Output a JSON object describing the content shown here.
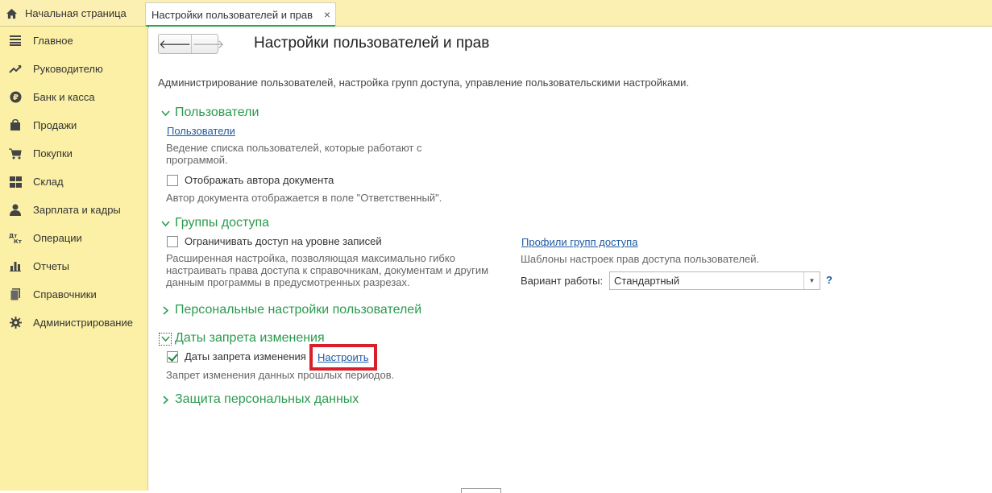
{
  "topbar": {
    "home_label": "Начальная страница",
    "active_tab_label": "Настройки пользователей и прав",
    "close_glyph": "×"
  },
  "sidebar": {
    "items": [
      {
        "label": "Главное",
        "icon": "menu-lines-icon"
      },
      {
        "label": "Руководителю",
        "icon": "trend-up-icon"
      },
      {
        "label": "Банк и касса",
        "icon": "ruble-coin-icon"
      },
      {
        "label": "Продажи",
        "icon": "shopping-bag-icon"
      },
      {
        "label": "Покупки",
        "icon": "cart-icon"
      },
      {
        "label": "Склад",
        "icon": "warehouse-grid-icon"
      },
      {
        "label": "Зарплата и кадры",
        "icon": "person-icon"
      },
      {
        "label": "Операции",
        "icon": "dt-kt-icon"
      },
      {
        "label": "Отчеты",
        "icon": "bar-chart-icon"
      },
      {
        "label": "Справочники",
        "icon": "books-icon"
      },
      {
        "label": "Администрирование",
        "icon": "gear-icon"
      }
    ]
  },
  "nav": {
    "back_glyph": "🡐",
    "forward_glyph": "🡒"
  },
  "page": {
    "title": "Настройки пользователей и прав",
    "subtitle": "Администрирование пользователей, настройка групп доступа, управление пользовательскими настройками."
  },
  "users_section": {
    "header": "Пользователи",
    "link": "Пользователи",
    "link_desc_1": "Ведение списка пользователей, которые работают с",
    "link_desc_2": "программой.",
    "checkbox_label": "Отображать автора документа",
    "checkbox_checked": false,
    "checkbox_desc": "Автор документа отображается в поле \"Ответственный\"."
  },
  "access_section": {
    "header": "Группы доступа",
    "checkbox_label": "Ограничивать доступ на уровне записей",
    "checkbox_checked": false,
    "desc_1": "Расширенная настройка, позволяющая максимально гибко",
    "desc_2": "настраивать права доступа к справочникам, документам и другим",
    "desc_3": "данным программы в предусмотренных разрезах.",
    "profiles_link": "Профили групп доступа",
    "profiles_desc": "Шаблоны настроек прав доступа пользователей.",
    "mode_label": "Вариант работы:",
    "mode_value": "Стандартный",
    "help_glyph": "?"
  },
  "personal_section": {
    "header": "Персональные настройки пользователей"
  },
  "dates_section": {
    "header": "Даты запрета изменения",
    "checkbox_label": "Даты запрета изменения",
    "checkbox_checked": true,
    "configure_link": "Настроить",
    "desc": "Запрет изменения данных прошлых периодов."
  },
  "personal_data_section": {
    "header": "Защита персональных данных"
  },
  "colors": {
    "sidebar_bg": "#fbf0a6",
    "section_green": "#2a9a4c",
    "link_blue": "#1d5ba4",
    "highlight_red": "#d9202a"
  }
}
